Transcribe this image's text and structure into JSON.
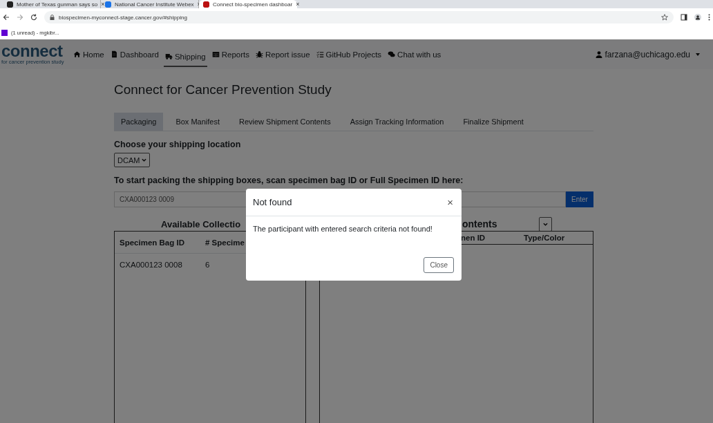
{
  "browser": {
    "tabs": [
      {
        "title": "Mother of Texas gunman says so",
        "close": "×",
        "selected": false
      },
      {
        "title": "National Cancer Institute Webex",
        "close": "×",
        "selected": false
      },
      {
        "title": "Connect bio-specimen dashboar",
        "close": "×",
        "selected": true
      }
    ],
    "url": "biospecimen-myconnect-stage.cancer.gov/#shipping",
    "bookmarks": [
      {
        "label": "(1 unread) - mgkibr..."
      }
    ]
  },
  "navbar": {
    "brand": "connect",
    "tagline": "for cancer prevention study",
    "items": [
      {
        "label": "Home",
        "selected": false
      },
      {
        "label": "Dashboard",
        "selected": false
      },
      {
        "label": "Shipping",
        "selected": true
      },
      {
        "label": "Reports",
        "selected": false
      },
      {
        "label": "Report issue",
        "selected": false
      },
      {
        "label": "GitHub Projects",
        "selected": false
      },
      {
        "label": "Chat with us",
        "selected": false
      }
    ],
    "user": "farzana@uchicago.edu"
  },
  "page": {
    "title": "Connect for Cancer Prevention Study",
    "steps": [
      {
        "label": "Packaging",
        "selected": true
      },
      {
        "label": "Box Manifest",
        "selected": false
      },
      {
        "label": "Review Shipment Contents",
        "selected": false
      },
      {
        "label": "Assign Tracking Information",
        "selected": false
      },
      {
        "label": "Finalize Shipment",
        "selected": false
      }
    ],
    "location_label": "Choose your shipping location",
    "location": "DCAM",
    "scan_label": "To start packing the shipping boxes, scan specimen bag ID or Full Specimen ID here:",
    "scan_value": "CXA000123 0009",
    "enter_button": "Enter",
    "left_panel": {
      "heading": "Available Collectio",
      "columns": [
        "Specimen Bag ID",
        "# Specime"
      ],
      "rows": [
        [
          "CXA000123 0008",
          "6"
        ]
      ]
    },
    "right_panel": {
      "heading": "ontents",
      "columns": [
        "nen ID",
        "Type/Color"
      ]
    }
  },
  "modal": {
    "title": "Not found",
    "close_icon": "×",
    "body": "The participant with entered search criteria not found!",
    "close_button": "Close"
  }
}
